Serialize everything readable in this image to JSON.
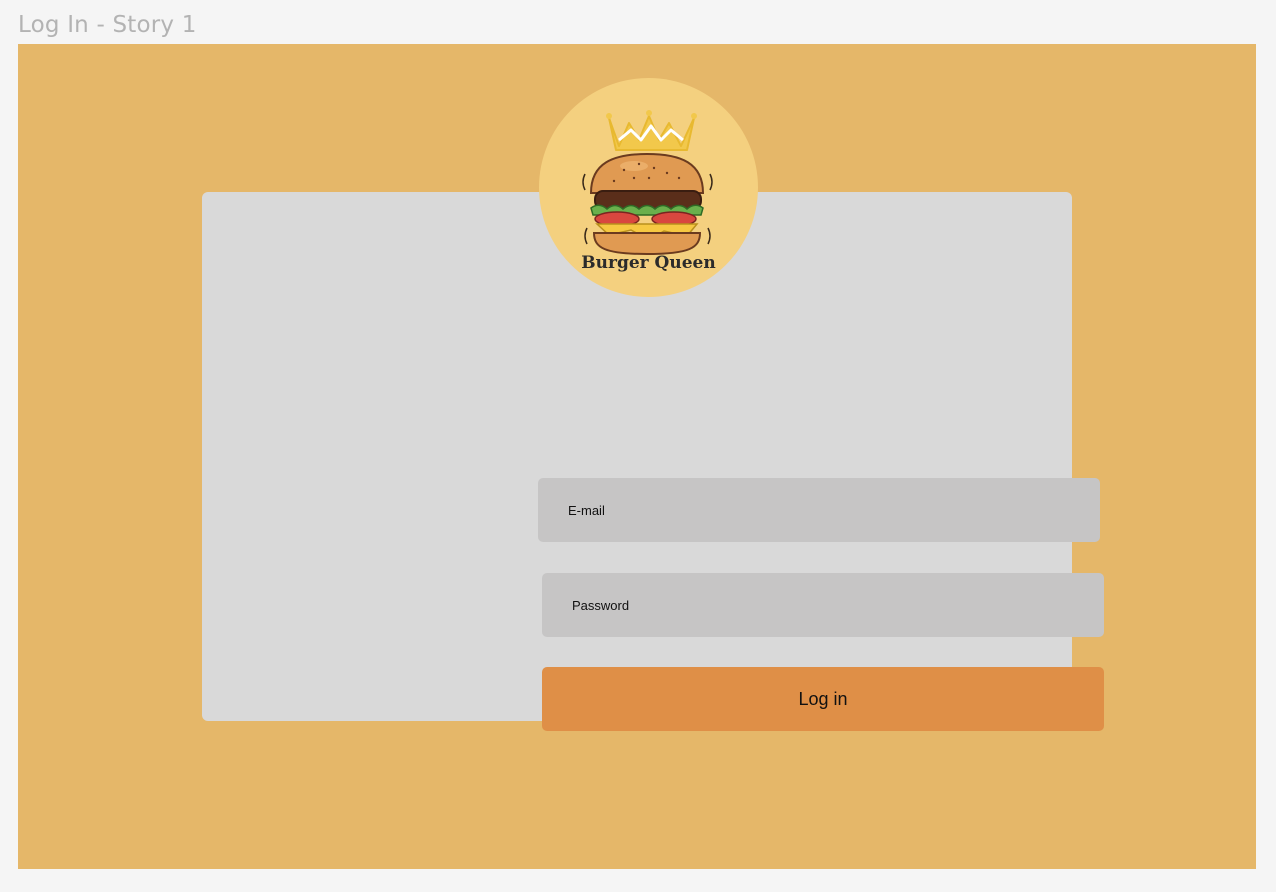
{
  "frame": {
    "title": "Log In - Story 1"
  },
  "logo": {
    "brand_name": "Burger Queen",
    "icons": [
      "crown-icon",
      "burger-icon"
    ]
  },
  "form": {
    "email_placeholder": "E-mail",
    "password_placeholder": "Password",
    "login_label": "Log in"
  },
  "colors": {
    "page_background": "#f5f5f5",
    "frame_background": "#e5b769",
    "card_background": "#d9d9d9",
    "logo_background": "#f4d07f",
    "input_background": "#c6c5c5",
    "button_background": "#df8f47"
  }
}
